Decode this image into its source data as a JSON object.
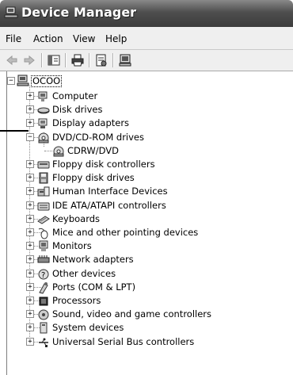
{
  "window": {
    "title": "Device Manager",
    "title_icon": "device-manager-icon"
  },
  "menu": [
    {
      "label": "File"
    },
    {
      "label": "Action"
    },
    {
      "label": "View"
    },
    {
      "label": "Help"
    }
  ],
  "toolbar": [
    {
      "icon": "back-arrow-icon"
    },
    {
      "icon": "forward-arrow-icon"
    },
    {
      "icon": "console-tree-icon"
    },
    {
      "icon": "print-icon"
    },
    {
      "icon": "properties-icon"
    },
    {
      "icon": "computer-view-icon"
    }
  ],
  "tree": {
    "root": {
      "label": "OCOO",
      "icon": "computer-icon",
      "expanded": true
    },
    "categories": [
      {
        "label": "Computer",
        "icon": "computer-icon",
        "expanded": false
      },
      {
        "label": "Disk drives",
        "icon": "disk-drive-icon",
        "expanded": false
      },
      {
        "label": "Display adapters",
        "icon": "display-adapter-icon",
        "expanded": false
      },
      {
        "label": "DVD/CD-ROM drives",
        "icon": "optical-drive-icon",
        "expanded": true,
        "children": [
          {
            "label": "CDRW/DVD",
            "icon": "optical-drive-icon"
          }
        ]
      },
      {
        "label": "Floppy disk controllers",
        "icon": "floppy-controller-icon",
        "expanded": false
      },
      {
        "label": "Floppy disk drives",
        "icon": "floppy-drive-icon",
        "expanded": false
      },
      {
        "label": "Human Interface Devices",
        "icon": "hid-icon",
        "expanded": false
      },
      {
        "label": "IDE ATA/ATAPI controllers",
        "icon": "ide-controller-icon",
        "expanded": false
      },
      {
        "label": "Keyboards",
        "icon": "keyboard-icon",
        "expanded": false
      },
      {
        "label": "Mice and other pointing devices",
        "icon": "mouse-icon",
        "expanded": false
      },
      {
        "label": "Monitors",
        "icon": "monitor-icon",
        "expanded": false
      },
      {
        "label": "Network adapters",
        "icon": "network-adapter-icon",
        "expanded": false
      },
      {
        "label": "Other devices",
        "icon": "unknown-device-icon",
        "expanded": false
      },
      {
        "label": "Ports (COM & LPT)",
        "icon": "port-icon",
        "expanded": false
      },
      {
        "label": "Processors",
        "icon": "processor-icon",
        "expanded": false
      },
      {
        "label": "Sound, video and game controllers",
        "icon": "sound-icon",
        "expanded": false
      },
      {
        "label": "System devices",
        "icon": "system-device-icon",
        "expanded": false
      },
      {
        "label": "Universal Serial Bus controllers",
        "icon": "usb-icon",
        "expanded": false
      }
    ]
  }
}
